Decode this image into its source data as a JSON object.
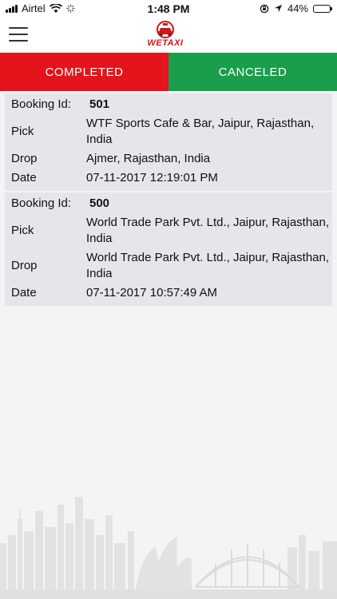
{
  "status_bar": {
    "carrier": "Airtel",
    "time": "1:48 PM",
    "battery": "44%",
    "battery_level": 0.44
  },
  "nav": {
    "logo_text": "WETAXI"
  },
  "tabs": [
    {
      "label": "COMPLETED",
      "color": "#e3141b"
    },
    {
      "label": "CANCELED",
      "color": "#1a9e4b"
    }
  ],
  "bookings": [
    {
      "id_label": "Booking Id:",
      "id": "501",
      "pick_label": "Pick",
      "pick": "WTF Sports Cafe & Bar, Jaipur, Rajasthan, India",
      "drop_label": "Drop",
      "drop": "Ajmer, Rajasthan, India",
      "date_label": "Date",
      "date": "07-11-2017 12:19:01 PM"
    },
    {
      "id_label": "Booking Id:",
      "id": "500",
      "pick_label": "Pick",
      "pick": "World Trade Park Pvt. Ltd., Jaipur, Rajasthan, India",
      "drop_label": "Drop",
      "drop": "World Trade Park Pvt. Ltd., Jaipur, Rajasthan, India",
      "date_label": "Date",
      "date": "07-11-2017 10:57:49 AM"
    }
  ]
}
